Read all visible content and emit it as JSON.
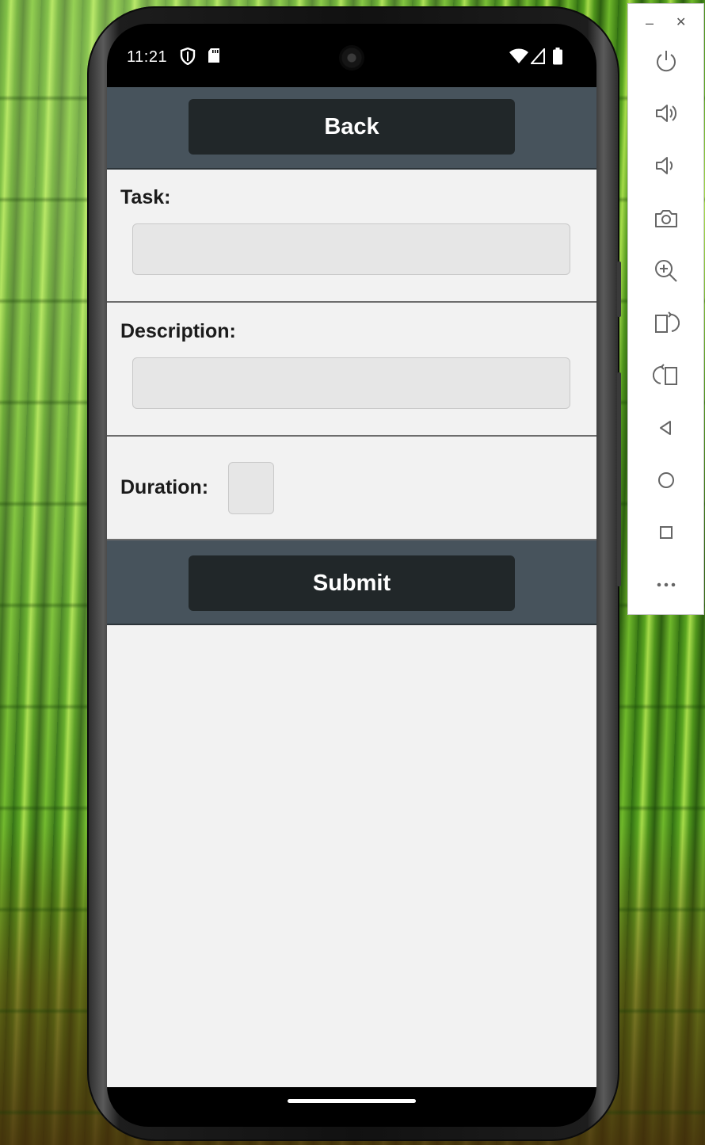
{
  "status_bar": {
    "time": "11:21",
    "left_icons": [
      "shield-icon",
      "sd-card-icon"
    ],
    "right_icons": [
      "wifi-icon",
      "cell-signal-icon",
      "battery-icon"
    ]
  },
  "app": {
    "back_button": "Back",
    "task_label": "Task:",
    "task_value": "",
    "description_label": "Description:",
    "description_value": "",
    "duration_label": "Duration:",
    "duration_value": "",
    "submit_button": "Submit",
    "colors": {
      "bar": "#47535c",
      "button": "#212729",
      "background": "#f2f2f2",
      "field": "#e6e6e6"
    }
  },
  "emulator_panel": {
    "window_controls": [
      "minimize-icon",
      "close-icon"
    ],
    "minimize_glyph": "–",
    "close_glyph": "✕",
    "tools": [
      "power-icon",
      "volume-up-icon",
      "volume-down-icon",
      "camera-icon",
      "zoom-icon",
      "rotate-right-icon",
      "rotate-left-icon",
      "back-icon",
      "home-icon",
      "overview-icon",
      "more-icon"
    ]
  }
}
